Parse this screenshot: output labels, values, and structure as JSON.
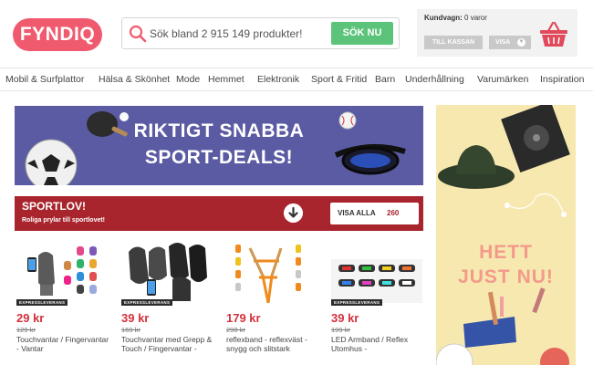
{
  "header": {
    "logo": "FYNDIQ",
    "search": {
      "placeholder": "Sök bland 2 915 149 produkter!",
      "button": "SÖK NU"
    },
    "cart": {
      "label": "Kundvagn:",
      "status": "0 varor",
      "checkout": "TILL KASSAN",
      "show": "VISA"
    }
  },
  "nav": {
    "items": [
      "Mobil & Surfplattor",
      "Hälsa & Skönhet",
      "Mode",
      "Hemmet",
      "Elektronik",
      "Sport & Fritid",
      "Barn",
      "Underhållning",
      "Varumärken",
      "Inspiration"
    ]
  },
  "banner": {
    "line1": "RIKTIGT SNABBA",
    "line2": "SPORT-DEALS!"
  },
  "sportlov": {
    "title": "SPORTLOV!",
    "subtitle": "Roliga prylar till sportlovet!",
    "view_all": "VISA ALLA",
    "count": "260"
  },
  "products": [
    {
      "price": "29 kr",
      "old_price": "129 kr",
      "name": "Touchvantar / Fingervantar - Vantar",
      "badge": "EXPRESSLEVERANS"
    },
    {
      "price": "39 kr",
      "old_price": "169 kr",
      "name": "Touchvantar med Grepp & Touch / Fingervantar -",
      "badge": "EXPRESSLEVERANS"
    },
    {
      "price": "179 kr",
      "old_price": "298 kr",
      "name": "reflexband - reflexväst - snygg och slitstark",
      "badge": ""
    },
    {
      "price": "39 kr",
      "old_price": "199 kr",
      "name": "LED Armband / Reflex Utomhus -",
      "badge": "EXPRESSLEVERANS"
    }
  ],
  "promo": {
    "line1": "HETT",
    "line2": "JUST NU!"
  },
  "colors": {
    "brand": "#f05a6e",
    "search_button": "#5cc47a",
    "sportlov": "#a8252d",
    "banner": "#5b5ba4",
    "price": "#d4313d",
    "promo_bg": "#f7e8b0"
  }
}
